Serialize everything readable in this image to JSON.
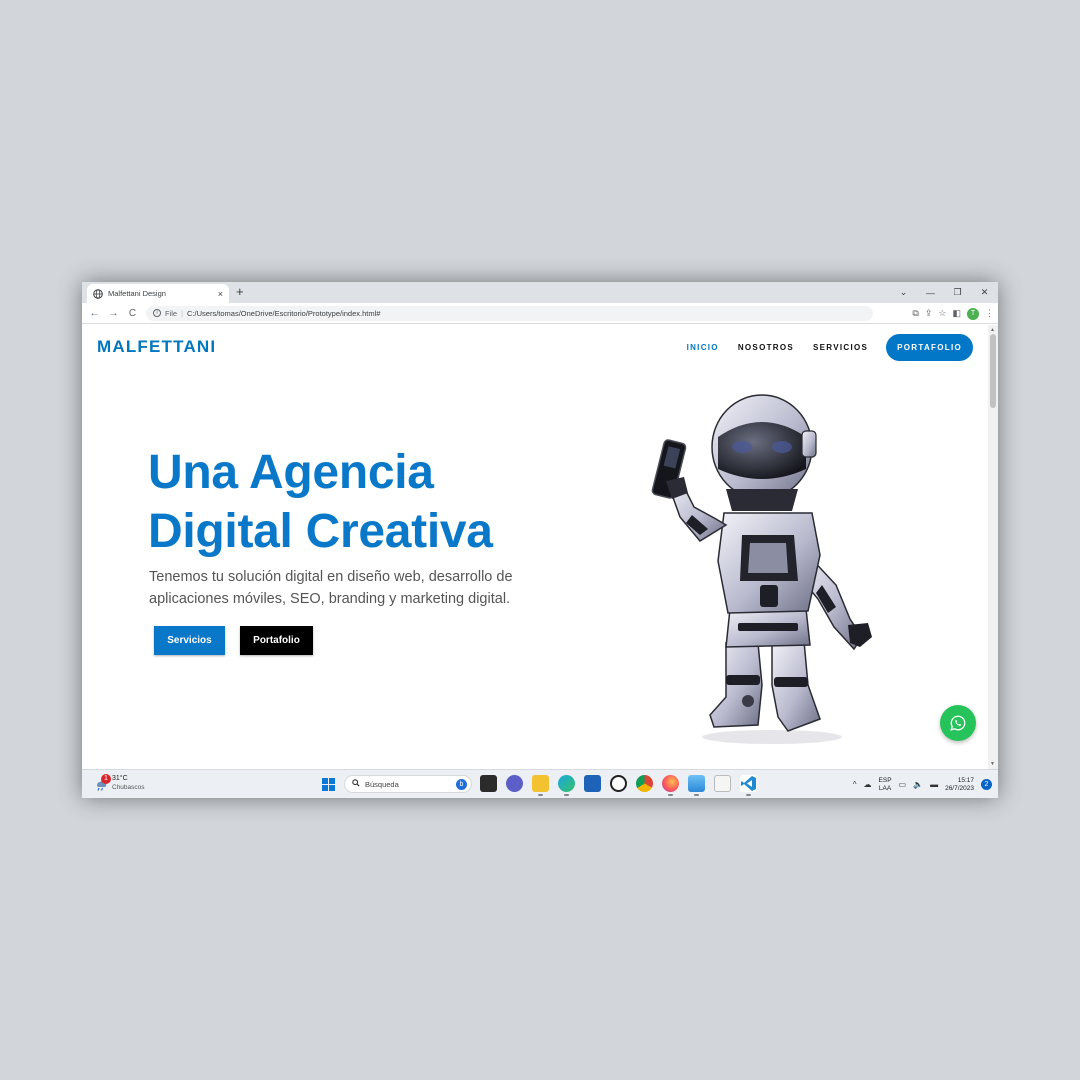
{
  "browser": {
    "tab_title": "Malfettani Design",
    "tab_close": "×",
    "new_tab": "+",
    "window_controls": [
      "⌄",
      "—",
      "❐",
      "✕"
    ],
    "nav_buttons": [
      "←",
      "→",
      "C"
    ],
    "address_scheme": "File",
    "address_path": "C:/Users/tomas/OneDrive/Escritorio/Prototype/index.html#",
    "profile_initial": "T",
    "toolbar_icons": [
      "translate-icon",
      "share-icon",
      "star-icon",
      "sidepanel-icon",
      "menu-icon"
    ]
  },
  "site": {
    "logo": "MALFETTANI",
    "nav": {
      "inicio": "INICIO",
      "nosotros": "NOSOTROS",
      "servicios": "SERVICIOS",
      "portafolio": "PORTAFOLIO"
    },
    "hero": {
      "title_line1": "Una Agencia",
      "title_line2": "Digital Creativa",
      "subtitle": "Tenemos tu solución digital en diseño web, desarrollo de aplicaciones móviles, SEO, branding y marketing digital.",
      "btn_servicios": "Servicios",
      "btn_portafolio": "Portafolio"
    },
    "colors": {
      "brand_blue": "#0a78c8",
      "whatsapp_green": "#25c35a",
      "black": "#000000"
    }
  },
  "taskbar": {
    "weather_badge": "1",
    "weather_temp": "31°C",
    "weather_cond": "Chubascos",
    "search_placeholder": "Búsqueda",
    "search_bing": "b",
    "apps": [
      "start-icon",
      "task-view-icon",
      "chat-icon",
      "file-explorer-icon",
      "edge-icon",
      "store-icon",
      "dell-icon",
      "chrome-icon",
      "firefox-icon",
      "photos-icon",
      "notepad-icon",
      "vscode-icon"
    ],
    "tray_chevron": "^",
    "lang_line1": "ESP",
    "lang_line2": "LAA",
    "time": "15:17",
    "date": "26/7/2023",
    "notifications": "2"
  }
}
